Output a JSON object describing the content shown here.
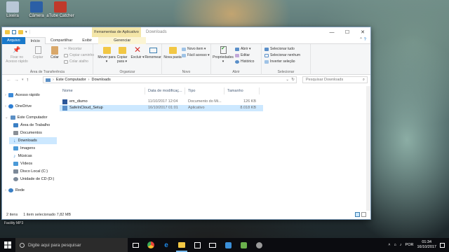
{
  "desktop": {
    "icons": [
      {
        "label": "Lixeira",
        "color": "#b8c7d6"
      },
      {
        "label": "Câmera",
        "color": "#2b5fa6"
      },
      {
        "label": "aTube Catcher",
        "color": "#c0392b"
      }
    ],
    "below_window_text": "Facility      MP3"
  },
  "window": {
    "context_tab": "Ferramentas de Aplicativo",
    "title": "Downloads",
    "controls": {
      "minimize": "—",
      "maximize": "☐",
      "close": "✕"
    }
  },
  "ribbon_tabs": {
    "file": "Arquivo",
    "home": "Início",
    "share": "Compartilhar",
    "view": "Exibir",
    "manage": "Gerenciar"
  },
  "ribbon": {
    "clipboard": {
      "label": "Área de Transferência",
      "pin": "Fixar no Acesso rápido",
      "copy": "Copiar",
      "paste": "Colar",
      "cut": "Recortar",
      "copy_path": "Copiar caminho",
      "paste_shortcut": "Colar atalho"
    },
    "organize": {
      "label": "Organizar",
      "move_to": "Mover para ▾",
      "copy_to": "Copiar para ▾",
      "delete": "Excluir ▾",
      "rename": "Renomear"
    },
    "new": {
      "label": "Novo",
      "new_folder": "Nova pasta",
      "new_item": "Novo item ▾",
      "easy_access": "Fácil acesso ▾"
    },
    "open": {
      "label": "Abrir",
      "properties": "Propriedades ▾",
      "open": "Abrir ▾",
      "edit": "Editar",
      "history": "Histórico"
    },
    "select": {
      "label": "Selecionar",
      "select_all": "Selecionar tudo",
      "select_none": "Selecionar nenhum",
      "invert": "Inverter seleção"
    }
  },
  "address": {
    "segments": [
      "Este Computador",
      "Downloads"
    ],
    "search_placeholder": "Pesquisar Downloads"
  },
  "nav": [
    {
      "label": "Acesso rápido",
      "color": "#3c8ad8",
      "level": 0,
      "group": true
    },
    {
      "label": "OneDrive",
      "color": "#2f7fd3",
      "level": 0,
      "group": true
    },
    {
      "label": "Este Computador",
      "color": "#5b8fc5",
      "level": 0,
      "group": true
    },
    {
      "label": "Área de Trabalho",
      "color": "#3a7fc4",
      "level": 1
    },
    {
      "label": "Documentos",
      "color": "#8a8f96",
      "level": 1
    },
    {
      "label": "Downloads",
      "color": "#2f7fd3",
      "level": 1,
      "selected": true
    },
    {
      "label": "Imagens",
      "color": "#4b9ad8",
      "level": 1
    },
    {
      "label": "Músicas",
      "color": "#4b9ad8",
      "level": 1
    },
    {
      "label": "Vídeos",
      "color": "#4b9ad8",
      "level": 1
    },
    {
      "label": "Disco Local (C:)",
      "color": "#7d8a99",
      "level": 1
    },
    {
      "label": "Unidade de CD (D:)",
      "color": "#7d8a99",
      "level": 1
    },
    {
      "label": "Rede",
      "color": "#3a7fc4",
      "level": 0,
      "group": true
    }
  ],
  "columns": {
    "name": "Nome",
    "date": "Data de modificaç...",
    "type": "Tipo",
    "size": "Tamanho"
  },
  "files": [
    {
      "name": "em_diumo",
      "date": "11/10/2017 12:04",
      "type": "Documento do Mi...",
      "size": "126 KB",
      "icon_color": "#2b579a"
    },
    {
      "name": "SafeInCloud_Setup",
      "date": "16/10/2017 01:01",
      "type": "Aplicativo",
      "size": "8.018 KB",
      "icon_color": "#5a8fc9",
      "selected": true
    }
  ],
  "status": {
    "count": "2 itens",
    "selection": "1 item selecionado  7,82 MB"
  },
  "taskbar": {
    "search_placeholder": "Digite aqui para pesquisar",
    "apps": [
      {
        "name": "task-view-icon",
        "color": "#ffffff"
      },
      {
        "name": "edge-icon",
        "color": "#1e88e5"
      },
      {
        "name": "file-explorer-icon",
        "color": "#f2c744",
        "active": true
      },
      {
        "name": "store-icon",
        "color": "#ffffff"
      },
      {
        "name": "mail-icon",
        "color": "#ffffff"
      },
      {
        "name": "chrome-icon",
        "color": "#e9453a"
      },
      {
        "name": "ie-icon",
        "color": "#3a8fd8"
      },
      {
        "name": "firefox-icon",
        "color": "#e66000"
      },
      {
        "name": "media-icon",
        "color": "#6ab04c"
      }
    ],
    "language": "POR",
    "time": "01:34",
    "date": "16/10/2017"
  }
}
